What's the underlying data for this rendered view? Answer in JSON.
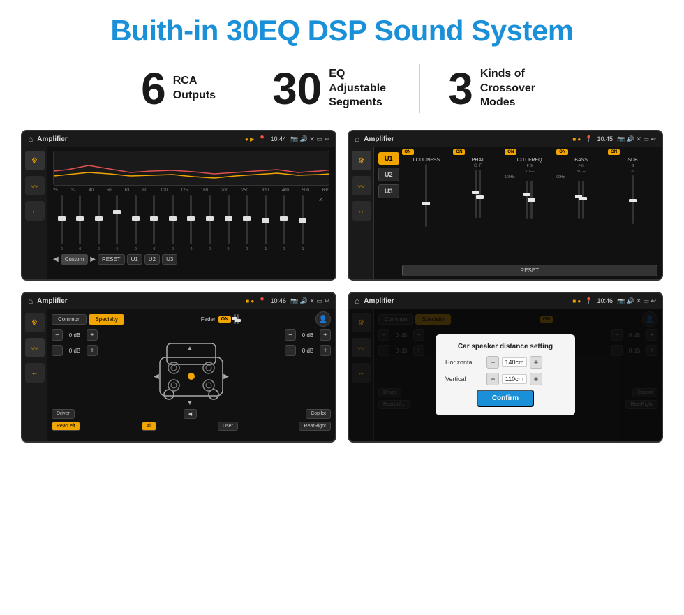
{
  "header": {
    "title": "Buith-in 30EQ DSP Sound System"
  },
  "stats": [
    {
      "number": "6",
      "label": "RCA\nOutputs"
    },
    {
      "number": "30",
      "label": "EQ Adjustable\nSegments"
    },
    {
      "number": "3",
      "label": "Kinds of\nCrossover Modes"
    }
  ],
  "screens": [
    {
      "id": "eq-screen",
      "statusbar": {
        "app": "Amplifier",
        "time": "10:44"
      },
      "type": "eq"
    },
    {
      "id": "amp-screen",
      "statusbar": {
        "app": "Amplifier",
        "time": "10:45"
      },
      "type": "amp"
    },
    {
      "id": "fader-screen",
      "statusbar": {
        "app": "Amplifier",
        "time": "10:46"
      },
      "type": "fader"
    },
    {
      "id": "dialog-screen",
      "statusbar": {
        "app": "Amplifier",
        "time": "10:46"
      },
      "type": "dialog"
    }
  ],
  "eq": {
    "frequencies": [
      "25",
      "32",
      "40",
      "50",
      "63",
      "80",
      "100",
      "125",
      "160",
      "200",
      "250",
      "320",
      "400",
      "500",
      "630"
    ],
    "values": [
      "0",
      "0",
      "0",
      "5",
      "0",
      "0",
      "0",
      "0",
      "0",
      "0",
      "0",
      "-1",
      "0",
      "-1"
    ],
    "preset": "Custom",
    "buttons": [
      "RESET",
      "U1",
      "U2",
      "U3"
    ]
  },
  "amp": {
    "presets": [
      "U1",
      "U2",
      "U3"
    ],
    "controls": [
      "LOUDNESS",
      "PHAT",
      "CUT FREQ",
      "BASS",
      "SUB"
    ],
    "resetBtn": "RESET"
  },
  "fader": {
    "tabs": [
      "Common",
      "Specialty"
    ],
    "activeTab": "Specialty",
    "faderLabel": "Fader",
    "onLabel": "ON",
    "dbValues": [
      "0 dB",
      "0 dB",
      "0 dB",
      "0 dB"
    ],
    "bottomBtns": [
      "Driver",
      "Copilot",
      "RearLeft",
      "All",
      "User",
      "RearRight"
    ]
  },
  "dialog": {
    "title": "Car speaker distance setting",
    "horizontal": {
      "label": "Horizontal",
      "value": "140cm"
    },
    "vertical": {
      "label": "Vertical",
      "value": "110cm"
    },
    "confirmBtn": "Confirm",
    "dbValues": [
      "0 dB",
      "0 dB"
    ]
  }
}
